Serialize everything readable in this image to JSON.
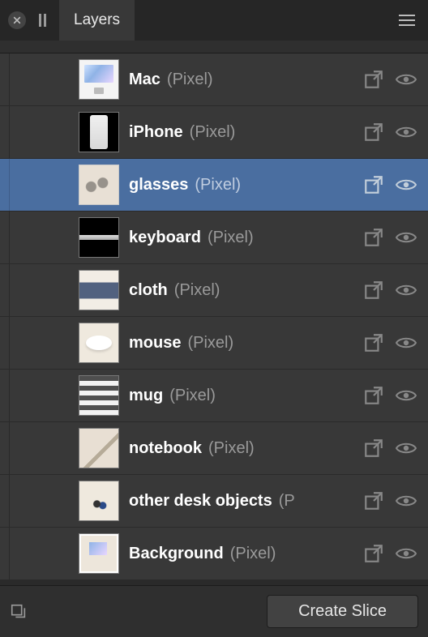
{
  "header": {
    "tab_title": "Layers"
  },
  "footer": {
    "create_slice_label": "Create Slice"
  },
  "layers": [
    {
      "name": "Mac",
      "type": "(Pixel)",
      "selected": false,
      "thumb": "thumb-mac"
    },
    {
      "name": "iPhone",
      "type": "(Pixel)",
      "selected": false,
      "thumb": "thumb-iphone"
    },
    {
      "name": "glasses",
      "type": "(Pixel)",
      "selected": true,
      "thumb": "thumb-glasses"
    },
    {
      "name": "keyboard",
      "type": "(Pixel)",
      "selected": false,
      "thumb": "thumb-keyboard"
    },
    {
      "name": "cloth",
      "type": "(Pixel)",
      "selected": false,
      "thumb": "thumb-cloth"
    },
    {
      "name": "mouse",
      "type": "(Pixel)",
      "selected": false,
      "thumb": "thumb-mouse"
    },
    {
      "name": "mug",
      "type": "(Pixel)",
      "selected": false,
      "thumb": "thumb-mug"
    },
    {
      "name": "notebook",
      "type": "(Pixel)",
      "selected": false,
      "thumb": "thumb-notebook"
    },
    {
      "name": "other desk objects",
      "type": "(Pixel)",
      "selected": false,
      "thumb": "thumb-otherdesk",
      "truncated": true
    },
    {
      "name": "Background",
      "type": "(Pixel)",
      "selected": false,
      "thumb": "thumb-background"
    }
  ]
}
